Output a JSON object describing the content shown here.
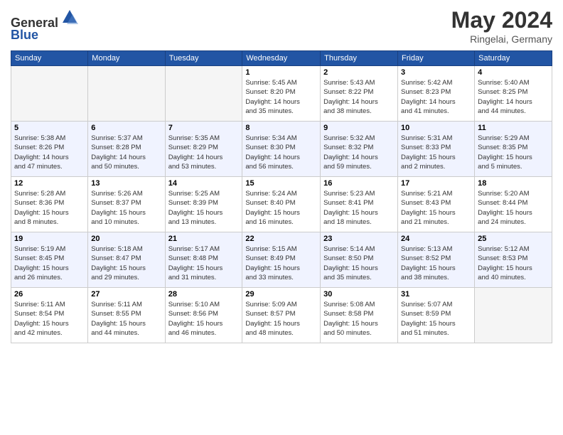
{
  "header": {
    "logo_general": "General",
    "logo_blue": "Blue",
    "month": "May 2024",
    "location": "Ringelai, Germany"
  },
  "weekdays": [
    "Sunday",
    "Monday",
    "Tuesday",
    "Wednesday",
    "Thursday",
    "Friday",
    "Saturday"
  ],
  "weeks": [
    [
      {
        "date": "",
        "info": ""
      },
      {
        "date": "",
        "info": ""
      },
      {
        "date": "",
        "info": ""
      },
      {
        "date": "1",
        "info": "Sunrise: 5:45 AM\nSunset: 8:20 PM\nDaylight: 14 hours\nand 35 minutes."
      },
      {
        "date": "2",
        "info": "Sunrise: 5:43 AM\nSunset: 8:22 PM\nDaylight: 14 hours\nand 38 minutes."
      },
      {
        "date": "3",
        "info": "Sunrise: 5:42 AM\nSunset: 8:23 PM\nDaylight: 14 hours\nand 41 minutes."
      },
      {
        "date": "4",
        "info": "Sunrise: 5:40 AM\nSunset: 8:25 PM\nDaylight: 14 hours\nand 44 minutes."
      }
    ],
    [
      {
        "date": "5",
        "info": "Sunrise: 5:38 AM\nSunset: 8:26 PM\nDaylight: 14 hours\nand 47 minutes."
      },
      {
        "date": "6",
        "info": "Sunrise: 5:37 AM\nSunset: 8:28 PM\nDaylight: 14 hours\nand 50 minutes."
      },
      {
        "date": "7",
        "info": "Sunrise: 5:35 AM\nSunset: 8:29 PM\nDaylight: 14 hours\nand 53 minutes."
      },
      {
        "date": "8",
        "info": "Sunrise: 5:34 AM\nSunset: 8:30 PM\nDaylight: 14 hours\nand 56 minutes."
      },
      {
        "date": "9",
        "info": "Sunrise: 5:32 AM\nSunset: 8:32 PM\nDaylight: 14 hours\nand 59 minutes."
      },
      {
        "date": "10",
        "info": "Sunrise: 5:31 AM\nSunset: 8:33 PM\nDaylight: 15 hours\nand 2 minutes."
      },
      {
        "date": "11",
        "info": "Sunrise: 5:29 AM\nSunset: 8:35 PM\nDaylight: 15 hours\nand 5 minutes."
      }
    ],
    [
      {
        "date": "12",
        "info": "Sunrise: 5:28 AM\nSunset: 8:36 PM\nDaylight: 15 hours\nand 8 minutes."
      },
      {
        "date": "13",
        "info": "Sunrise: 5:26 AM\nSunset: 8:37 PM\nDaylight: 15 hours\nand 10 minutes."
      },
      {
        "date": "14",
        "info": "Sunrise: 5:25 AM\nSunset: 8:39 PM\nDaylight: 15 hours\nand 13 minutes."
      },
      {
        "date": "15",
        "info": "Sunrise: 5:24 AM\nSunset: 8:40 PM\nDaylight: 15 hours\nand 16 minutes."
      },
      {
        "date": "16",
        "info": "Sunrise: 5:23 AM\nSunset: 8:41 PM\nDaylight: 15 hours\nand 18 minutes."
      },
      {
        "date": "17",
        "info": "Sunrise: 5:21 AM\nSunset: 8:43 PM\nDaylight: 15 hours\nand 21 minutes."
      },
      {
        "date": "18",
        "info": "Sunrise: 5:20 AM\nSunset: 8:44 PM\nDaylight: 15 hours\nand 24 minutes."
      }
    ],
    [
      {
        "date": "19",
        "info": "Sunrise: 5:19 AM\nSunset: 8:45 PM\nDaylight: 15 hours\nand 26 minutes."
      },
      {
        "date": "20",
        "info": "Sunrise: 5:18 AM\nSunset: 8:47 PM\nDaylight: 15 hours\nand 29 minutes."
      },
      {
        "date": "21",
        "info": "Sunrise: 5:17 AM\nSunset: 8:48 PM\nDaylight: 15 hours\nand 31 minutes."
      },
      {
        "date": "22",
        "info": "Sunrise: 5:15 AM\nSunset: 8:49 PM\nDaylight: 15 hours\nand 33 minutes."
      },
      {
        "date": "23",
        "info": "Sunrise: 5:14 AM\nSunset: 8:50 PM\nDaylight: 15 hours\nand 35 minutes."
      },
      {
        "date": "24",
        "info": "Sunrise: 5:13 AM\nSunset: 8:52 PM\nDaylight: 15 hours\nand 38 minutes."
      },
      {
        "date": "25",
        "info": "Sunrise: 5:12 AM\nSunset: 8:53 PM\nDaylight: 15 hours\nand 40 minutes."
      }
    ],
    [
      {
        "date": "26",
        "info": "Sunrise: 5:11 AM\nSunset: 8:54 PM\nDaylight: 15 hours\nand 42 minutes."
      },
      {
        "date": "27",
        "info": "Sunrise: 5:11 AM\nSunset: 8:55 PM\nDaylight: 15 hours\nand 44 minutes."
      },
      {
        "date": "28",
        "info": "Sunrise: 5:10 AM\nSunset: 8:56 PM\nDaylight: 15 hours\nand 46 minutes."
      },
      {
        "date": "29",
        "info": "Sunrise: 5:09 AM\nSunset: 8:57 PM\nDaylight: 15 hours\nand 48 minutes."
      },
      {
        "date": "30",
        "info": "Sunrise: 5:08 AM\nSunset: 8:58 PM\nDaylight: 15 hours\nand 50 minutes."
      },
      {
        "date": "31",
        "info": "Sunrise: 5:07 AM\nSunset: 8:59 PM\nDaylight: 15 hours\nand 51 minutes."
      },
      {
        "date": "",
        "info": ""
      }
    ]
  ]
}
